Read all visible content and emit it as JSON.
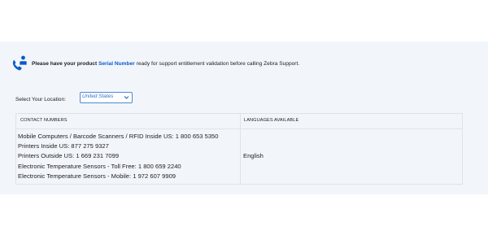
{
  "notice": {
    "prefix": "Please have your product ",
    "link_label": "Serial Number",
    "suffix": " ready for support entitlement validation before calling Zebra Support.",
    "icon": "phone-support-icon"
  },
  "location": {
    "label": "Select Your Location:",
    "selected": "United States"
  },
  "table": {
    "headers": {
      "contacts": "CONTACT NUMBERS",
      "languages": "LANGUAGES AVAILABLE"
    },
    "contacts": [
      "Mobile Computers / Barcode Scanners / RFID Inside US: 1 800 653 5350",
      "Printers Inside US: 877 275 9327",
      "Printers Outside US: 1 669 231 7099",
      "Electronic Temperature Sensors - Toll Free: 1 800 659 2240",
      "Electronic Temperature Sensors - Mobile: 1 972 607 9909"
    ],
    "language": "English"
  },
  "colors": {
    "accent": "#0d59c9",
    "panel_bg": "#f2f6fb"
  }
}
